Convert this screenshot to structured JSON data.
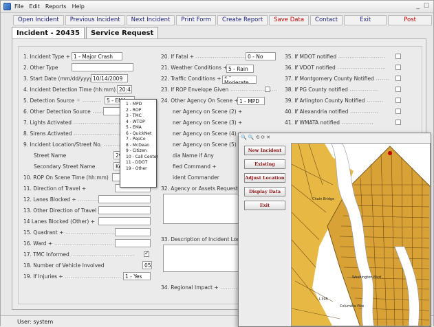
{
  "menu": [
    "File",
    "Edit",
    "Reports",
    "Help"
  ],
  "window_controls": [
    "_",
    "☐"
  ],
  "toolbar": [
    {
      "label": "Open Incident",
      "color": "#1c1c7a"
    },
    {
      "label": "Previous Incident",
      "color": "#1c1c7a"
    },
    {
      "label": "Next Incident",
      "color": "#1c1c7a"
    },
    {
      "label": "Print Form",
      "color": "#1c1c7a"
    },
    {
      "label": "Create Report",
      "color": "#1c1c7a"
    },
    {
      "label": "Save Data",
      "color": "#c00000"
    },
    {
      "label": "Contact",
      "color": "#1c1c7a"
    },
    {
      "label": "Exit",
      "color": "#1c1c7a"
    },
    {
      "label": "Post",
      "color": "#c00000"
    }
  ],
  "tabs": [
    "Incident - 20435",
    "Service Request"
  ],
  "col1": {
    "f1": {
      "label": "1. Incident Type +",
      "value": "1 - Major Crash"
    },
    "f2": {
      "label": "2. Other Type",
      "value": ""
    },
    "f3": {
      "label": "3. Start Date (mm/dd/yyyy)",
      "value": "10/14/2009"
    },
    "f4": {
      "label": "4. Incident Detection Time (hh:mm)",
      "value": "20:41"
    },
    "f5": {
      "label": "5. Detection Source",
      "value": "5 - EMA"
    },
    "f6": {
      "label": "6. Other Detection Source",
      "value": ""
    },
    "f7": {
      "label": "7. Lights Activated"
    },
    "f8": {
      "label": "8. Sirens Activated"
    },
    "f9": {
      "label": "9. Incident Location/Street No."
    },
    "street_name": {
      "label": "Street Name",
      "value": "295"
    },
    "secondary_street": {
      "label": "Secondary Street Name",
      "value": "Ken"
    },
    "f10": {
      "label": "10. ROP On Scene Time (hh:mm)",
      "value": ""
    },
    "f11": {
      "label": "11. Direction of Travel +",
      "value": ""
    },
    "f12": {
      "label": "12. Lanes Blocked +",
      "value": ""
    },
    "f13": {
      "label": "13. Other Direction of Travel",
      "value": ""
    },
    "f14": {
      "label": "14 Lanes Blocked (Other) +",
      "value": ""
    },
    "f15": {
      "label": "15. Quadrant +",
      "value": ""
    },
    "f16": {
      "label": "16. Ward +",
      "value": ""
    },
    "f17": {
      "label": "17. TMC Informed"
    },
    "f18": {
      "label": "18. Number of Vehicle Involved",
      "value": "05"
    },
    "f19": {
      "label": "19. If Injuries +",
      "value": "1 - Yes"
    }
  },
  "col2": {
    "f20": {
      "label": "20. If Fatal +",
      "value": "0 - No"
    },
    "f21": {
      "label": "21. Weather Conditions +",
      "value": "5 - Rain"
    },
    "f22": {
      "label": "22. Traffic Conditions +",
      "value": "2 - Moderate"
    },
    "f23": {
      "label": "23. If ROP Envelope Given"
    },
    "f24": {
      "label": "24. Other Agency On Scene +",
      "value": "1 - MPD"
    },
    "f25": {
      "label": "ner Agency on Scene (2) +"
    },
    "f26": {
      "label": "ner Agency on Scene (3) +"
    },
    "f27": {
      "label": "ner Agency on Scene (4) +"
    },
    "f28": {
      "label": "ner Agency on Scene (5) +"
    },
    "f29": {
      "label": "dia Name if Any"
    },
    "f30": {
      "label": "fied Command +"
    },
    "f31": {
      "label": "ident Commander"
    },
    "f32": {
      "label": "32. Agency or Assets Requested"
    },
    "f33": {
      "label": "33. Description of Incident Location"
    },
    "f34": {
      "label": "34. Regional Impact +"
    }
  },
  "col3": [
    "35. If MDOT notified",
    "36. If VDOT notified",
    "37. If Montgomery County Notified",
    "38. If PG County notified",
    "39. If Arlington County Notified",
    "40. If Alexandria notified",
    "41. If WMATA notified"
  ],
  "detection_options": [
    "1 - MPD",
    "2 - ROP",
    "3 - TMC",
    "4 - WTOP",
    "5 - EMA",
    "6 - QuickNet",
    "7 - PepCo",
    "8 - McDean",
    "9 - Citizen",
    "10 - Call Center",
    "11 - DDOT",
    "19 - Other"
  ],
  "map_window": {
    "tools": [
      "🔍",
      "🔍",
      "⟲",
      "⟳",
      "✕"
    ],
    "buttons": [
      "New Incident",
      "Existing",
      "Adjust Location",
      "Display Data",
      "Exit"
    ],
    "map_labels": [
      "Washington Blvd",
      "Columbia Pike",
      "I-395",
      "Chain Bridge"
    ],
    "colors": {
      "land": "#e0ad36",
      "roads": "#5a3a10",
      "water": "#b8c8dc",
      "diamond": "#9a7a2a"
    }
  },
  "status": {
    "text": "User: system"
  }
}
